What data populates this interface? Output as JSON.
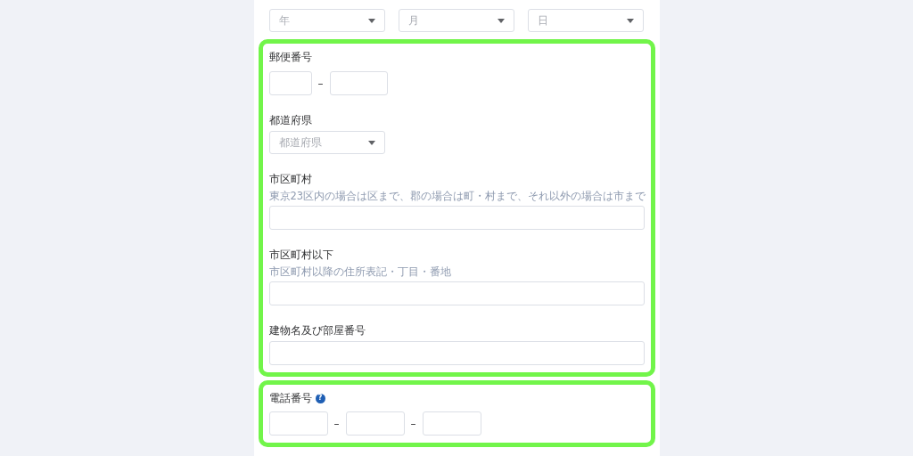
{
  "date_selects": [
    {
      "placeholder": "年"
    },
    {
      "placeholder": "月"
    },
    {
      "placeholder": "日"
    }
  ],
  "address_group": {
    "highlighted": true,
    "fields": [
      {
        "kind": "split",
        "label": "郵便番号",
        "separator": "–"
      },
      {
        "kind": "select",
        "label": "都道府県",
        "placeholder": "都道府県"
      },
      {
        "kind": "text",
        "label": "市区町村",
        "hint": "東京23区内の場合は区まで、郡の場合は町・村まで、それ以外の場合は市まで"
      },
      {
        "kind": "text",
        "label": "市区町村以下",
        "hint": "市区町村以降の住所表記・丁目・番地"
      },
      {
        "kind": "text",
        "label": "建物名及び部屋番号"
      }
    ]
  },
  "phone_group": {
    "highlighted": true,
    "label": "電話番号",
    "help_icon": "?",
    "separator": "–"
  }
}
